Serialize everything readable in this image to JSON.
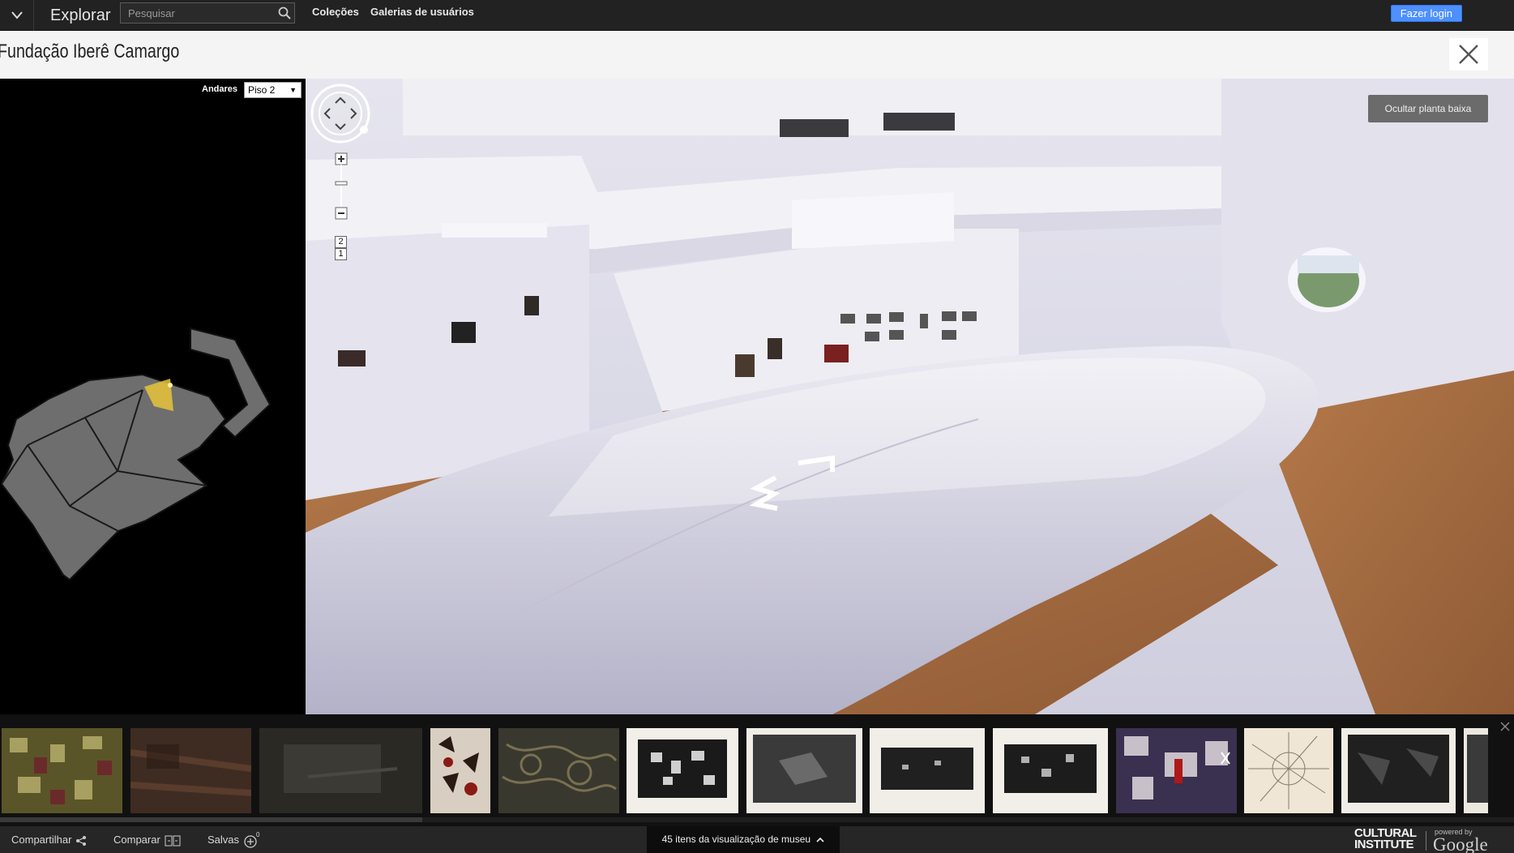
{
  "header": {
    "explore_label": "Explorar",
    "search_placeholder": "Pesquisar",
    "nav": [
      "Coleções",
      "Galerias de usuários"
    ],
    "login_label": "Fazer login"
  },
  "view": {
    "title": "Fundação Iberê Camargo"
  },
  "floorplan": {
    "floors_label": "Andares",
    "selected_floor": "Piso 2"
  },
  "streetview": {
    "hide_plan_label": "Ocultar planta baixa",
    "floor_buttons": [
      "2",
      "1"
    ],
    "colors": {
      "wall": "#e9e8f1",
      "floor": "#a86b43",
      "railing": "#d6d4e2"
    }
  },
  "thumbnails": [
    {
      "name": "artwork-1",
      "colors": [
        "#4a4521",
        "#a8a060",
        "#6b2a2a"
      ]
    },
    {
      "name": "artwork-2",
      "colors": [
        "#3a2a20",
        "#6a4030",
        "#2a1a14"
      ]
    },
    {
      "name": "artwork-3",
      "colors": [
        "#262622",
        "#3c3a34",
        "#1c1b18"
      ]
    },
    {
      "name": "artwork-4",
      "colors": [
        "#d8cfc2",
        "#8a1a14",
        "#2a1a14"
      ]
    },
    {
      "name": "artwork-5",
      "colors": [
        "#3a3a30",
        "#7a7050",
        "#1e1e1a"
      ]
    },
    {
      "name": "artwork-6",
      "colors": [
        "#f2efe8",
        "#1a1a1a",
        "#808080"
      ]
    },
    {
      "name": "artwork-7",
      "colors": [
        "#f0ede6",
        "#3a3a3a",
        "#6a6a6a"
      ]
    },
    {
      "name": "artwork-8",
      "colors": [
        "#f1eee8",
        "#202020",
        "#5a5a5a"
      ]
    },
    {
      "name": "artwork-9",
      "colors": [
        "#f2efe9",
        "#1c1c1c",
        "#707070"
      ]
    },
    {
      "name": "artwork-10",
      "colors": [
        "#3a3050",
        "#c8c0c8",
        "#b01818"
      ]
    },
    {
      "name": "artwork-11",
      "colors": [
        "#efe6d6",
        "#b8a890",
        "#8a7a68"
      ]
    },
    {
      "name": "artwork-12",
      "colors": [
        "#f0ede6",
        "#202020",
        "#4a4a4a"
      ]
    },
    {
      "name": "artwork-13",
      "colors": [
        "#ece8e0",
        "#3a3a3a",
        "#6a6a6a"
      ]
    }
  ],
  "footer": {
    "share_label": "Compartilhar",
    "compare_label": "Comparar",
    "saved_label": "Salvas",
    "saved_count": "0",
    "museum_items_label": "45 itens da visualização de museu",
    "brand_line1": "CULTURAL",
    "brand_line2": "INSTITUTE",
    "powered_by": "powered by",
    "google": "Google"
  }
}
